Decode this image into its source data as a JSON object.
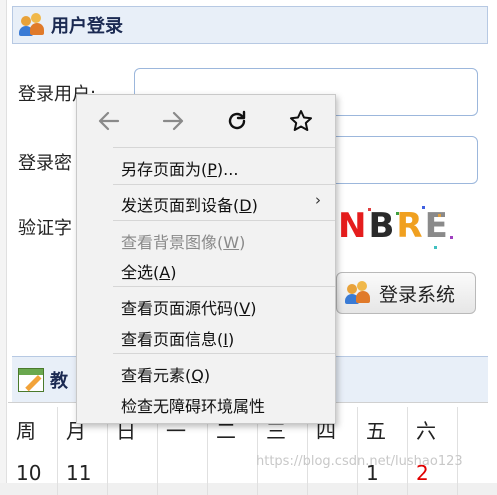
{
  "login_panel": {
    "title": "用户登录",
    "user_label": "登录用户:",
    "password_label": "登录密",
    "captcha_label": "验证字",
    "captcha_text": [
      "N",
      "B",
      "R",
      "E"
    ],
    "captcha_colors": [
      "#e51d1d",
      "#2a2a2a",
      "#f0a020",
      "#8a8a8a"
    ],
    "login_button": "登录系统"
  },
  "schedule_panel": {
    "title": "教",
    "weekdays": [
      "周",
      "月",
      "日",
      "一",
      "二",
      "三",
      "四",
      "五",
      "六"
    ],
    "row1": [
      "10",
      "11",
      "",
      "",
      "",
      "",
      "",
      "1",
      "2"
    ]
  },
  "watermark": "https://blog.csdn.net/lushao123",
  "context_menu": {
    "nav": [
      "back-icon",
      "forward-icon",
      "reload-icon",
      "bookmark-star-icon"
    ],
    "items": [
      {
        "label": "另存页面为(P)...",
        "key": "P",
        "pre": "另存页面为(",
        "post": ")..."
      },
      {
        "label": "发送页面到设备(D)",
        "key": "D",
        "pre": "发送页面到设备(",
        "post": ")",
        "submenu": true
      },
      {
        "label": "查看背景图像(W)",
        "key": "W",
        "pre": "查看背景图像(",
        "post": ")",
        "disabled": true
      },
      {
        "label": "全选(A)",
        "key": "A",
        "pre": "全选(",
        "post": ")"
      },
      {
        "label": "查看页面源代码(V)",
        "key": "V",
        "pre": "查看页面源代码(",
        "post": ")"
      },
      {
        "label": "查看页面信息(I)",
        "key": "I",
        "pre": "查看页面信息(",
        "post": ")"
      },
      {
        "label": "查看元素(Q)",
        "key": "Q",
        "pre": "查看元素(",
        "post": ")"
      },
      {
        "label": "检查无障碍环境属性",
        "key": "",
        "pre": "检查无障碍环境属性",
        "post": ""
      }
    ]
  }
}
